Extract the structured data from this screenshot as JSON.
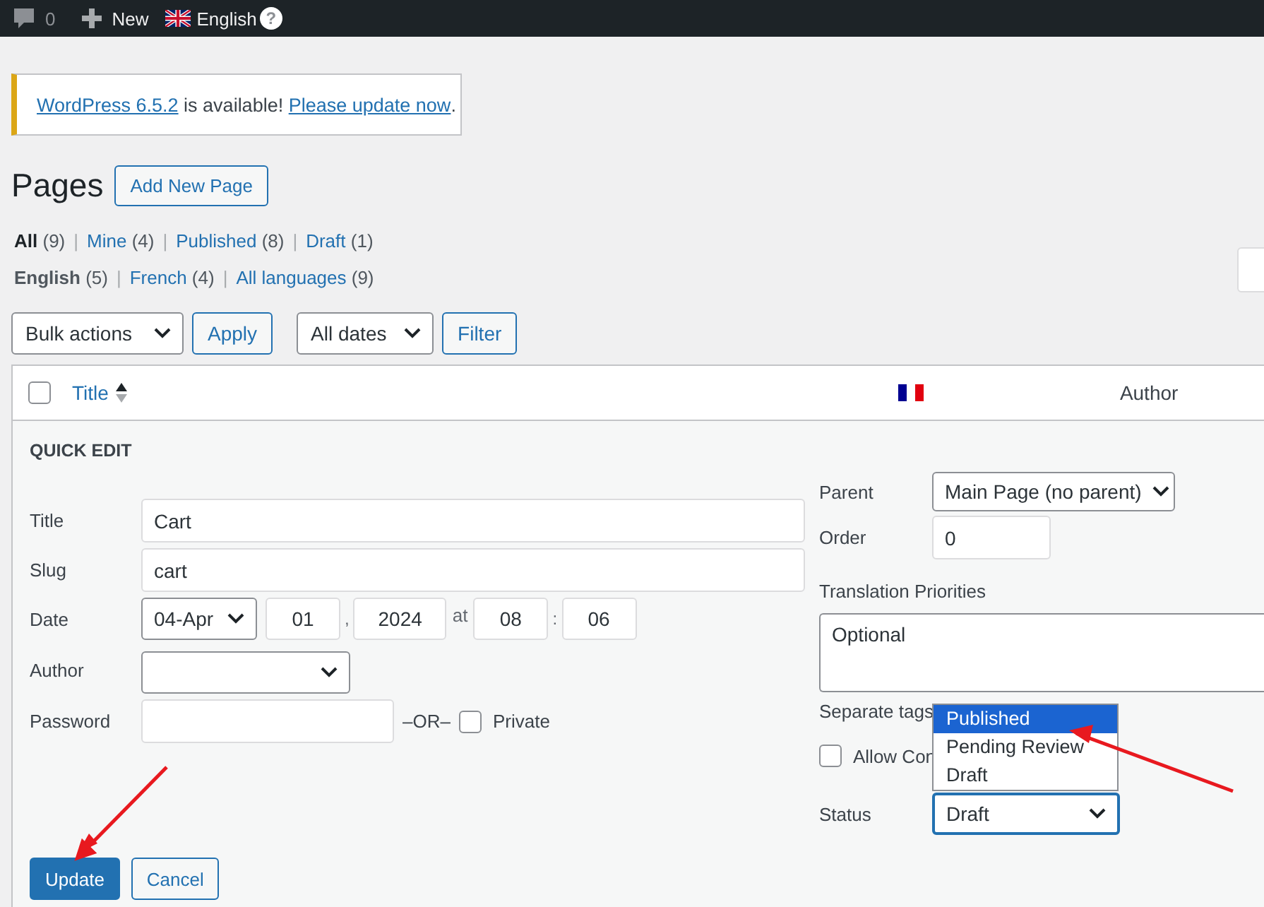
{
  "admin_bar": {
    "comments_count": "0",
    "new_label": "New",
    "language": "English",
    "help": "?"
  },
  "notice": {
    "link": "WordPress 6.5.2",
    "text": " is available! ",
    "action": "Please update now",
    "end": "."
  },
  "page_title": "Pages",
  "add_new": "Add New Page",
  "status_filters": [
    {
      "label": "All",
      "count": "(9)",
      "selected": true
    },
    {
      "separator": "|",
      "label": "Mine",
      "count": "(4)",
      "selected": false
    },
    {
      "separator": "|",
      "label": "Published",
      "count": "(8)",
      "selected": false
    },
    {
      "separator": "|",
      "label": "Draft",
      "count": "(1)",
      "selected": false
    }
  ],
  "language_filters": [
    {
      "label": "English",
      "count": "(5)",
      "selected": true
    },
    {
      "separator": "|",
      "label": "French",
      "count": "(4)",
      "selected": false
    },
    {
      "separator": "|",
      "label": "All languages",
      "count": "(9)",
      "selected": false
    }
  ],
  "toolbar": {
    "bulk_actions": "Bulk actions",
    "apply": "Apply",
    "date_filter": "All dates",
    "filter": "Filter"
  },
  "table": {
    "select_all_checked": false,
    "columns": [
      {
        "kind": "title",
        "label": "Title"
      },
      {
        "kind": "flag"
      },
      {
        "kind": "text",
        "label": "Author"
      }
    ]
  },
  "quick_edit": {
    "heading": "QUICK EDIT",
    "title": {
      "label": "Title",
      "value": "Cart"
    },
    "slug": {
      "label": "Slug",
      "value": "cart"
    },
    "date": {
      "label": "Date",
      "month": "04-Apr",
      "day": "01",
      "comma": ",",
      "year": "2024",
      "at": "at",
      "hour": "08",
      "colon": ":",
      "minute": "06"
    },
    "author": {
      "label": "Author"
    },
    "password": {
      "label": "Password",
      "or": "–OR–",
      "private_label": "Private",
      "private_checked": false
    },
    "parent": {
      "label": "Parent",
      "value": "Main Page (no parent)"
    },
    "order": {
      "label": "Order",
      "value": "0"
    },
    "translation": {
      "label": "Translation Priorities",
      "value": "Optional"
    },
    "tags_hint": "Separate tags",
    "allow_comments": {
      "label": "Allow Con",
      "checked": false
    },
    "status": {
      "label": "Status",
      "value": "Draft",
      "options": [
        {
          "label": "Published",
          "highlighted": true
        },
        {
          "label": "Pending Review",
          "highlighted": false
        },
        {
          "label": "Draft",
          "highlighted": false
        }
      ]
    },
    "update": "Update",
    "cancel": "Cancel"
  }
}
